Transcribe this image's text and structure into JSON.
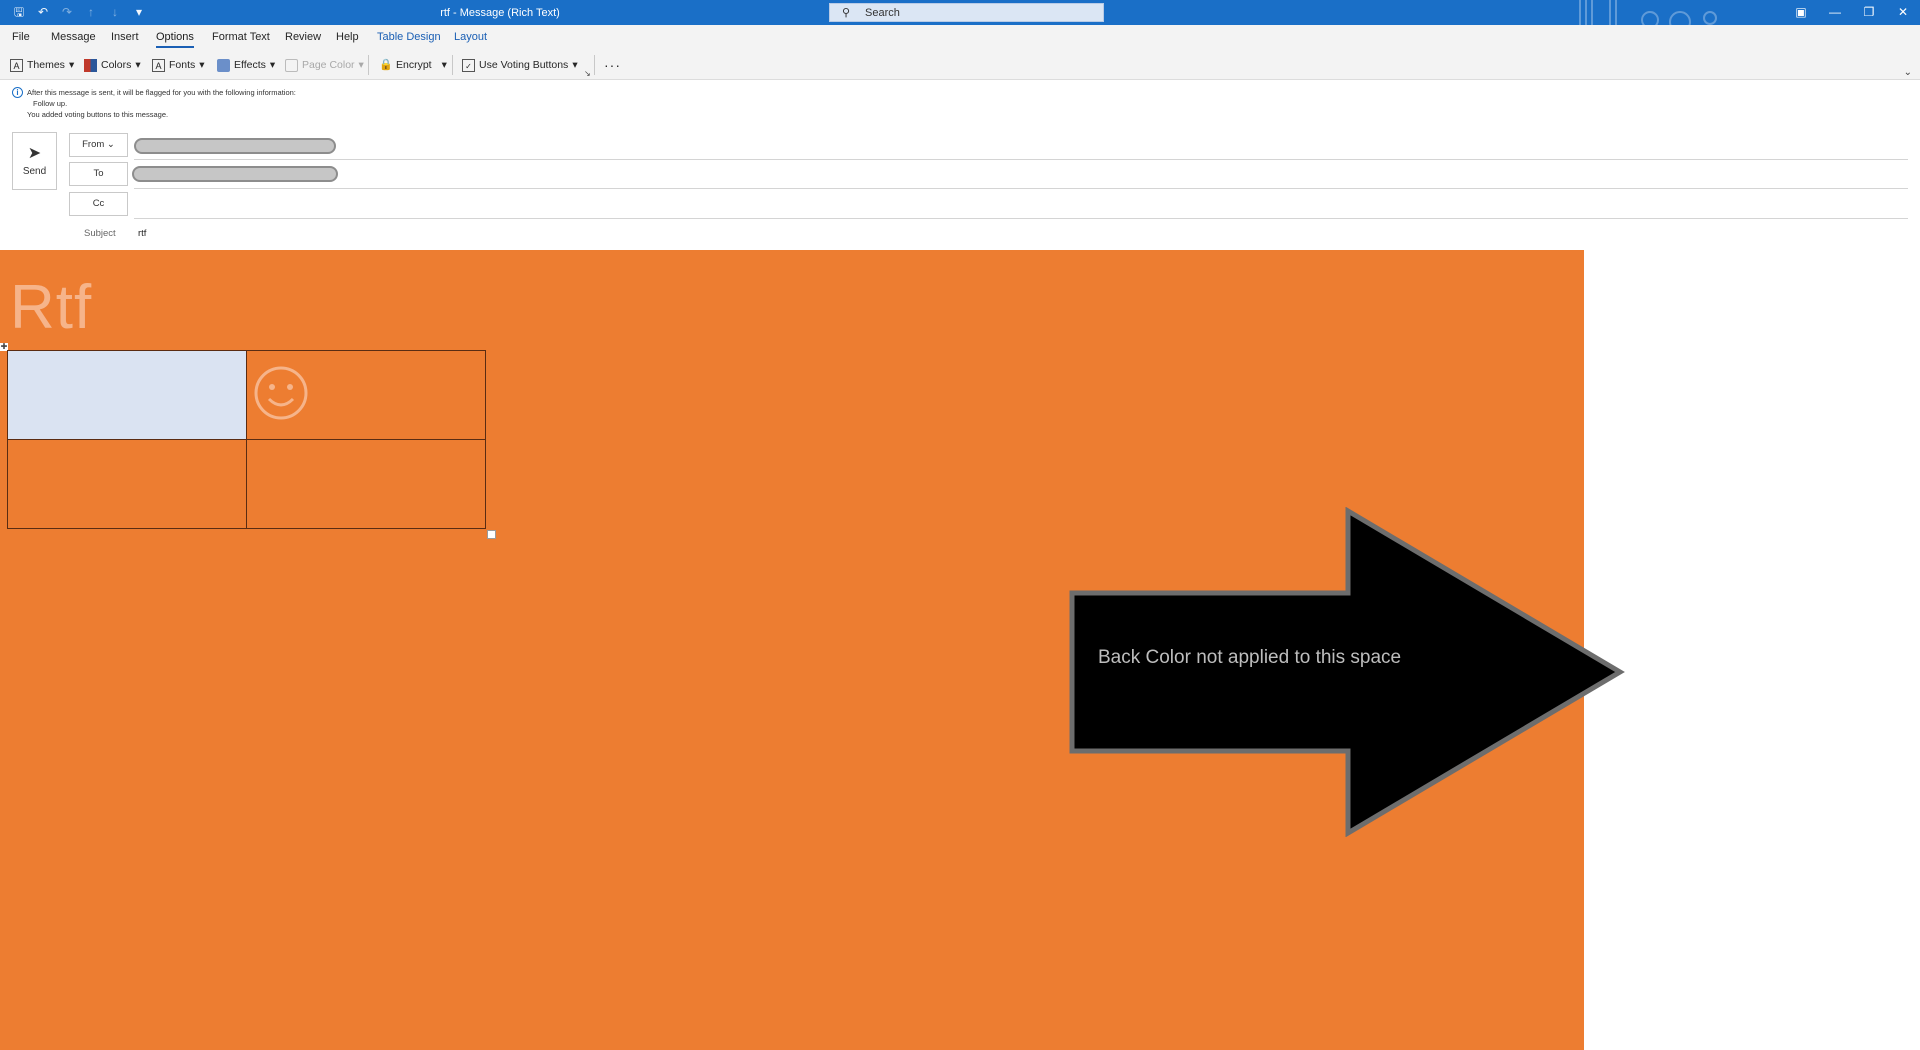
{
  "window": {
    "title": "rtf  -  Message (Rich Text)",
    "search_placeholder": "Search"
  },
  "tabs": [
    {
      "label": "File"
    },
    {
      "label": "Message"
    },
    {
      "label": "Insert"
    },
    {
      "label": "Options",
      "active": true
    },
    {
      "label": "Format Text"
    },
    {
      "label": "Review"
    },
    {
      "label": "Help"
    },
    {
      "label": "Table Design",
      "contextual": true
    },
    {
      "label": "Layout",
      "contextual": true
    }
  ],
  "ribbon": {
    "themes": "Themes",
    "colors": "Colors",
    "fonts": "Fonts",
    "effects": "Effects",
    "page_color": "Page Color",
    "encrypt": "Encrypt",
    "voting": "Use Voting Buttons",
    "more": "···"
  },
  "infobar": {
    "line1": "After this message is sent, it will be flagged for you with the following information:",
    "line2": "Follow up.",
    "line3": "You added voting buttons to this message."
  },
  "header": {
    "send": "Send",
    "from": "From",
    "to": "To",
    "cc": "Cc",
    "subject_label": "Subject",
    "subject_value": "rtf"
  },
  "body": {
    "heading": "Rtf",
    "table_smiley": "☺",
    "annotation": "Back Color not applied to this space",
    "background_color": "#ed7d31"
  },
  "colors": {
    "titlebar": "#1a6fc7",
    "accent": "#1a5fb4",
    "selected_cell": "#dae3f2"
  }
}
